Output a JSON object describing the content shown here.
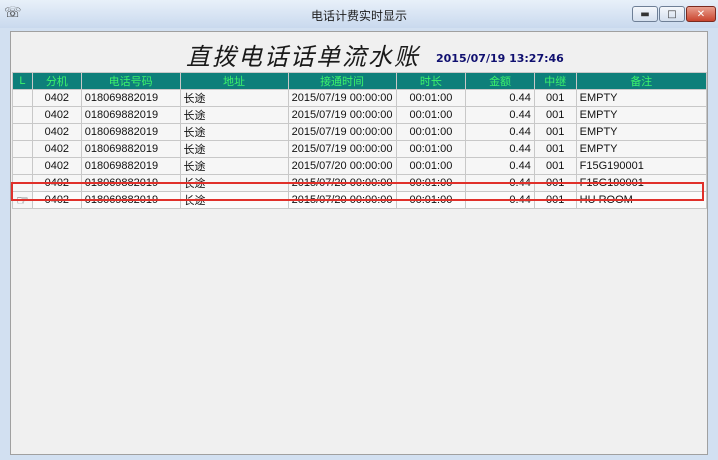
{
  "window": {
    "title": "电话计费实时显示",
    "icons": {
      "app": "phone-app-icon",
      "minimize": "minimize-icon",
      "maximize": "maximize-icon",
      "close": "close-icon"
    }
  },
  "header": {
    "title": "直拨电话话单流水账",
    "timestamp": "2015/07/19 13:27:46"
  },
  "table": {
    "columns": [
      "L",
      "分机",
      "电话号码",
      "地址",
      "接通时间",
      "时长",
      "金额",
      "中继",
      "备注"
    ],
    "rows": [
      {
        "ext": "0402",
        "phone": "018069882019",
        "addr": "长途",
        "time": "2015/07/19 00:00:00",
        "dur": "00:01:00",
        "amount": "0.44",
        "trunk": "001",
        "note": "EMPTY",
        "note_red": true
      },
      {
        "ext": "0402",
        "phone": "018069882019",
        "addr": "长途",
        "time": "2015/07/19 00:00:00",
        "dur": "00:01:00",
        "amount": "0.44",
        "trunk": "001",
        "note": "EMPTY",
        "note_red": true
      },
      {
        "ext": "0402",
        "phone": "018069882019",
        "addr": "长途",
        "time": "2015/07/19 00:00:00",
        "dur": "00:01:00",
        "amount": "0.44",
        "trunk": "001",
        "note": "EMPTY",
        "note_red": true
      },
      {
        "ext": "0402",
        "phone": "018069882019",
        "addr": "长途",
        "time": "2015/07/19 00:00:00",
        "dur": "00:01:00",
        "amount": "0.44",
        "trunk": "001",
        "note": "EMPTY",
        "note_red": true
      },
      {
        "ext": "0402",
        "phone": "018069882019",
        "addr": "长途",
        "time": "2015/07/20 00:00:00",
        "dur": "00:01:00",
        "amount": "0.44",
        "trunk": "001",
        "note": "F15G190001",
        "note_red": false
      },
      {
        "ext": "0402",
        "phone": "018069882019",
        "addr": "长途",
        "time": "2015/07/20 00:00:00",
        "dur": "00:01:00",
        "amount": "0.44",
        "trunk": "001",
        "note": "F15G190001",
        "note_red": false
      },
      {
        "ext": "0402",
        "phone": "018069882019",
        "addr": "长途",
        "time": "2015/07/20 00:00:00",
        "dur": "00:01:00",
        "amount": "0.44",
        "trunk": "001",
        "note": "HU ROOM",
        "note_red": false,
        "selected": true
      }
    ],
    "selected_row_icon": "pointing-hand-icon"
  },
  "colors": {
    "header_bg": "#0e7f7a",
    "header_text": "#3cf36c",
    "note_red": "#e21a1a",
    "selection": "#e0302a"
  }
}
